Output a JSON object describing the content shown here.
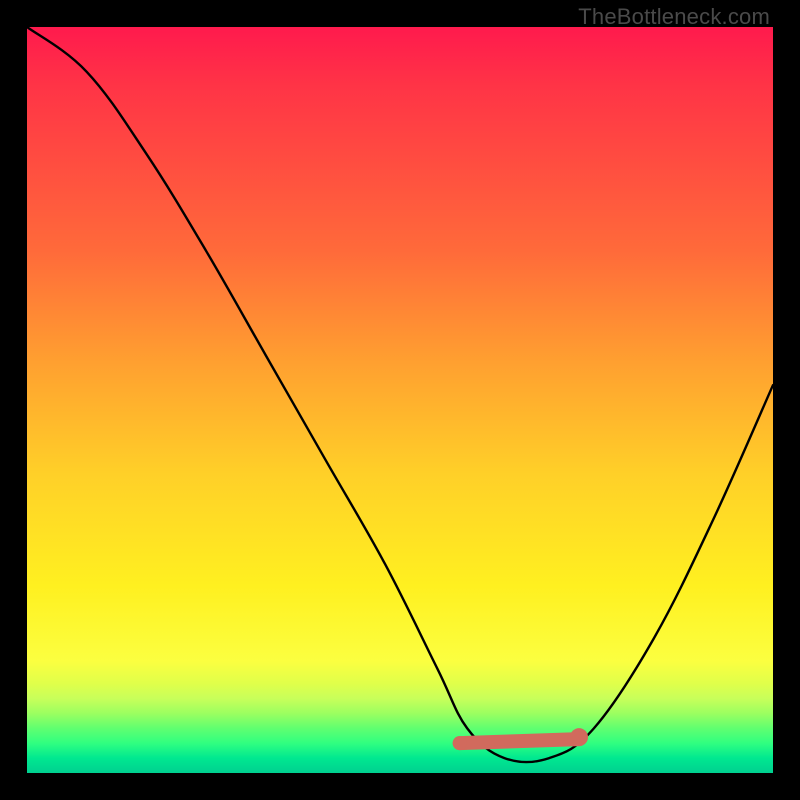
{
  "watermark": "TheBottleneck.com",
  "colors": {
    "page_bg": "#000000",
    "curve": "#000000",
    "flat_marker": "#d16a5d",
    "gradient_top": "#ff1a4d",
    "gradient_bottom": "#00d090"
  },
  "chart_data": {
    "type": "line",
    "title": "",
    "xlabel": "",
    "ylabel": "",
    "xlim": [
      0,
      100
    ],
    "ylim": [
      0,
      100
    ],
    "grid": false,
    "legend": false,
    "series": [
      {
        "name": "bottleneck-curve",
        "x": [
          0,
          8,
          16,
          24,
          32,
          40,
          48,
          55,
          59,
          64,
          70,
          76,
          84,
          92,
          100
        ],
        "values": [
          100,
          94,
          83,
          70,
          56,
          42,
          28,
          14,
          6,
          2,
          2,
          6,
          18,
          34,
          52
        ]
      }
    ],
    "annotations": [
      {
        "name": "flat-region",
        "x_start": 58,
        "x_end": 74,
        "y": 4,
        "color": "#d16a5d"
      }
    ]
  }
}
